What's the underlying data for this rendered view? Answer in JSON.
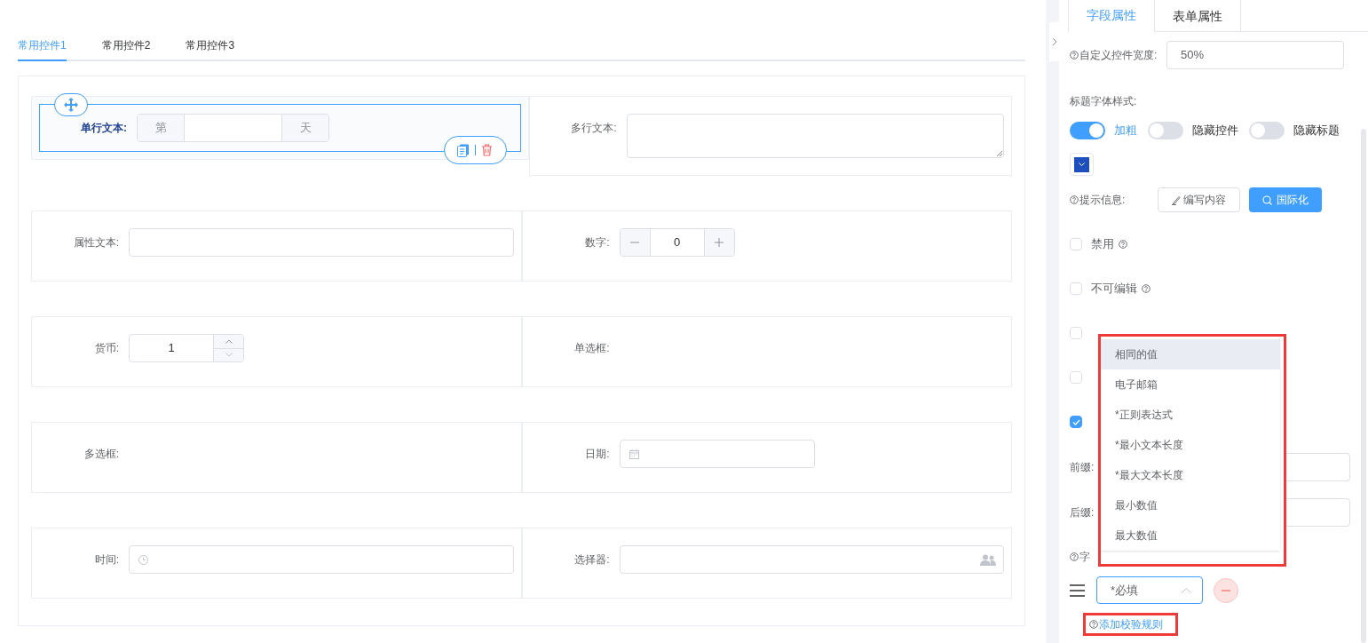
{
  "tabs": [
    {
      "label": "常用控件1",
      "selected": true
    },
    {
      "label": "常用控件2",
      "selected": false
    },
    {
      "label": "常用控件3",
      "selected": false
    }
  ],
  "rows": [
    {
      "fields": [
        {
          "kind": "affix",
          "label": "单行文本:",
          "prefix": "第",
          "suffix": "天",
          "selected": true
        },
        {
          "kind": "textarea",
          "label": "多行文本:",
          "selected": false
        }
      ]
    },
    {
      "fields": [
        {
          "kind": "text",
          "label": "属性文本:",
          "selected": false
        },
        {
          "kind": "number",
          "label": "数字:",
          "value": "0",
          "selected": false
        }
      ]
    },
    {
      "fields": [
        {
          "kind": "currency",
          "label": "货币:",
          "value": "1",
          "selected": false
        },
        {
          "kind": "radio",
          "label": "单选框:",
          "selected": false
        }
      ]
    },
    {
      "fields": [
        {
          "kind": "checkbox",
          "label": "多选框:",
          "selected": false
        },
        {
          "kind": "date",
          "label": "日期:",
          "selected": false
        }
      ]
    },
    {
      "fields": [
        {
          "kind": "time",
          "label": "时间:",
          "selected": false
        },
        {
          "kind": "selector",
          "label": "选择器:",
          "selected": false
        }
      ]
    }
  ],
  "side_panel": {
    "tabs": [
      {
        "label": "字段属性",
        "selected": true
      },
      {
        "label": "表单属性",
        "selected": false
      }
    ],
    "width_setting": {
      "label": "自定义控件宽度:",
      "value": "50%"
    },
    "title_style": {
      "label": "标题字体样式:",
      "switches": [
        {
          "label": "加粗",
          "on": true
        },
        {
          "label": "隐藏控件",
          "on": false
        },
        {
          "label": "隐藏标题",
          "on": false
        }
      ],
      "color": "#1f4fbf"
    },
    "hint": {
      "label": "提示信息:",
      "buttons": [
        {
          "label": "编写内容",
          "kind": "edit"
        },
        {
          "label": "国际化",
          "kind": "primary"
        }
      ]
    },
    "options": [
      {
        "label": "禁用",
        "checked": false,
        "help": true
      },
      {
        "label": "不可编辑",
        "checked": false,
        "help": true
      },
      {
        "checked": false
      },
      {
        "checked": false
      },
      {
        "checked": true
      }
    ],
    "prefix": {
      "label": "前缀:"
    },
    "suffix": {
      "label": "后缀:"
    },
    "rules": {
      "label": "字",
      "items": [
        {
          "value": "*必填",
          "expanded": true
        }
      ],
      "add_link": "添加校验规则"
    },
    "rule_dropdown": {
      "options": [
        {
          "label": "相同的值",
          "selected": true
        },
        {
          "label": "电子邮箱",
          "selected": false
        },
        {
          "label": "*正则表达式",
          "selected": false
        },
        {
          "label": "*最小文本长度",
          "selected": false
        },
        {
          "label": "*最大文本长度",
          "selected": false
        },
        {
          "label": "最小数值",
          "selected": false
        },
        {
          "label": "最大数值",
          "selected": false
        }
      ]
    }
  }
}
